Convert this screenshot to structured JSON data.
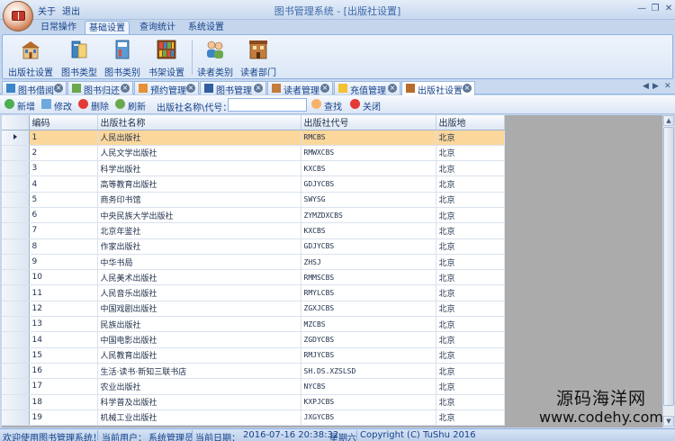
{
  "quick_access": {
    "about": "关于",
    "exit": "退出"
  },
  "window": {
    "title": "图书管理系统 - [出版社设置]"
  },
  "ribbon_tabs": [
    {
      "label": "日常操作",
      "active": false
    },
    {
      "label": "基础设置",
      "active": true
    },
    {
      "label": "查询统计",
      "active": false
    },
    {
      "label": "系统设置",
      "active": false
    }
  ],
  "ribbon_buttons": [
    {
      "label": "出版社设置",
      "icon": "building-icon"
    },
    {
      "label": "图书类型",
      "icon": "book-type-icon"
    },
    {
      "label": "图书类别",
      "icon": "book-category-icon"
    },
    {
      "label": "书架设置",
      "icon": "bookshelf-icon"
    },
    {
      "label": "读者类别",
      "icon": "reader-group-icon"
    },
    {
      "label": "读者部门",
      "icon": "department-icon"
    }
  ],
  "doc_tabs": [
    {
      "label": "图书借阅",
      "active": false
    },
    {
      "label": "图书归还",
      "active": false
    },
    {
      "label": "预约管理",
      "active": false
    },
    {
      "label": "图书管理",
      "active": false
    },
    {
      "label": "读者管理",
      "active": false
    },
    {
      "label": "充值管理",
      "active": false
    },
    {
      "label": "出版社设置",
      "active": true
    }
  ],
  "toolbar": {
    "add": "新增",
    "edit": "修改",
    "delete": "删除",
    "refresh": "刷新",
    "search_label": "出版社名称\\代号：",
    "search_value": "",
    "find": "查找",
    "close": "关闭"
  },
  "grid": {
    "columns": [
      "编码",
      "出版社名称",
      "出版社代号",
      "出版地"
    ],
    "selected_row": 0,
    "rows": [
      [
        "1",
        "人民出版社",
        "RMCBS",
        "北京"
      ],
      [
        "2",
        "人民文学出版社",
        "RMWXCBS",
        "北京"
      ],
      [
        "3",
        "科学出版社",
        "KXCBS",
        "北京"
      ],
      [
        "4",
        "高等教育出版社",
        "GDJYCBS",
        "北京"
      ],
      [
        "5",
        "商务印书馆",
        "SWYSG",
        "北京"
      ],
      [
        "6",
        "中央民族大学出版社",
        "ZYMZDXCBS",
        "北京"
      ],
      [
        "7",
        "北京年鉴社",
        "KXCBS",
        "北京"
      ],
      [
        "8",
        "作家出版社",
        "GDJYCBS",
        "北京"
      ],
      [
        "9",
        "中华书局",
        "ZHSJ",
        "北京"
      ],
      [
        "10",
        "人民美术出版社",
        "RMMSCBS",
        "北京"
      ],
      [
        "11",
        "人民音乐出版社",
        "RMYLCBS",
        "北京"
      ],
      [
        "12",
        "中国戏剧出版社",
        "ZGXJCBS",
        "北京"
      ],
      [
        "13",
        "民族出版社",
        "MZCBS",
        "北京"
      ],
      [
        "14",
        "中国电影出版社",
        "ZGDYCBS",
        "北京"
      ],
      [
        "15",
        "人民教育出版社",
        "RMJYCBS",
        "北京"
      ],
      [
        "16",
        "生活·读书·新知三联书店",
        "SH.DS.XZSLSD",
        "北京"
      ],
      [
        "17",
        "农业出版社",
        "NYCBS",
        "北京"
      ],
      [
        "18",
        "科学普及出版社",
        "KXPJCBS",
        "北京"
      ],
      [
        "19",
        "机械工业出版社",
        "JXGYCBS",
        "北京"
      ]
    ]
  },
  "status": {
    "welcome": "欢迎使用图书管理系统！",
    "user_label": "当前用户：",
    "user": "系统管理员",
    "date_label": "当前日期：",
    "date": "2016-07-16 20:38:32",
    "weekday": "星期六",
    "copyright": "Copyright (C) TuShu 2016"
  },
  "watermark": {
    "line1": "源码海洋网",
    "line2": "www.codehy.com"
  },
  "colors": {
    "accent": "#15428b",
    "selected_row": "#fbd79c",
    "ribbon_bg": "#dbe7f6"
  }
}
